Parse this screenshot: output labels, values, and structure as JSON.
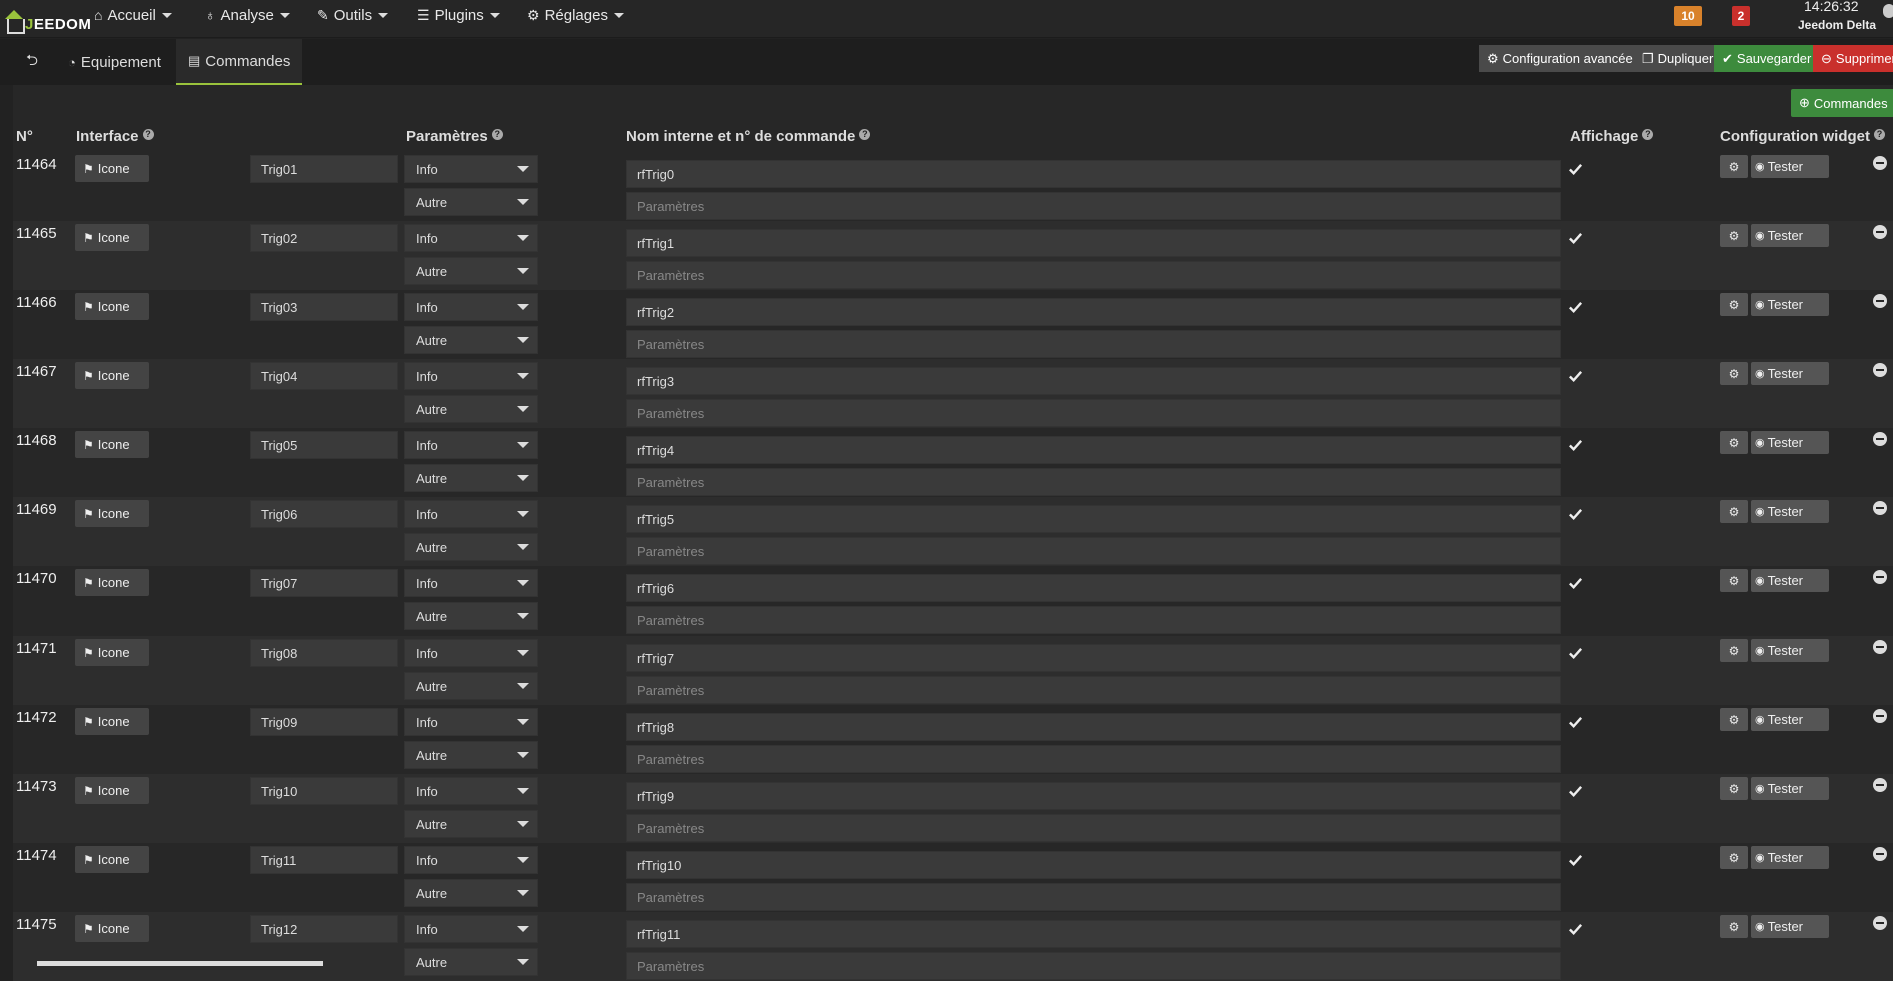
{
  "topbar": {
    "logo_prefix": "J",
    "logo_text": "EEDOM",
    "menus": [
      {
        "icon": "home-icon",
        "glyph": "⌂",
        "label": "Accueil"
      },
      {
        "icon": "stethoscope-icon",
        "glyph": "♁",
        "label": "Analyse"
      },
      {
        "icon": "wrench-icon",
        "glyph": "✎",
        "label": "Outils"
      },
      {
        "icon": "list-icon",
        "glyph": "☰",
        "label": "Plugins"
      },
      {
        "icon": "cogs-icon",
        "glyph": "⚙",
        "label": "Réglages"
      }
    ],
    "badges": [
      {
        "value": "10",
        "color": "#d9822b"
      },
      {
        "value": "2",
        "color": "#c9302c"
      }
    ],
    "time": "14:26:32",
    "host": "Jeedom Delta"
  },
  "tabs": {
    "back_glyph": "⮌",
    "equipement": "Equipement",
    "commandes": "Commandes"
  },
  "actions": {
    "config_avancee": "Configuration avancée",
    "dupliquer": "Dupliquer",
    "sauvegarder": "Sauvegarder",
    "supprimer": "Supprimer",
    "commandes": "Commandes"
  },
  "headers": {
    "num": "N°",
    "interface": "Interface",
    "parametres": "Paramètres",
    "nom_interne": "Nom interne et n° de commande",
    "affichage": "Affichage",
    "config_widget": "Configuration widget"
  },
  "labels": {
    "icone": "Icone",
    "tester": "Tester",
    "params_placeholder": "Paramètres"
  },
  "rows": [
    {
      "id": "11464",
      "name": "Trig01",
      "type": "Info",
      "subtype": "Autre",
      "logical": "rfTrig0"
    },
    {
      "id": "11465",
      "name": "Trig02",
      "type": "Info",
      "subtype": "Autre",
      "logical": "rfTrig1"
    },
    {
      "id": "11466",
      "name": "Trig03",
      "type": "Info",
      "subtype": "Autre",
      "logical": "rfTrig2"
    },
    {
      "id": "11467",
      "name": "Trig04",
      "type": "Info",
      "subtype": "Autre",
      "logical": "rfTrig3"
    },
    {
      "id": "11468",
      "name": "Trig05",
      "type": "Info",
      "subtype": "Autre",
      "logical": "rfTrig4"
    },
    {
      "id": "11469",
      "name": "Trig06",
      "type": "Info",
      "subtype": "Autre",
      "logical": "rfTrig5"
    },
    {
      "id": "11470",
      "name": "Trig07",
      "type": "Info",
      "subtype": "Autre",
      "logical": "rfTrig6"
    },
    {
      "id": "11471",
      "name": "Trig08",
      "type": "Info",
      "subtype": "Autre",
      "logical": "rfTrig7"
    },
    {
      "id": "11472",
      "name": "Trig09",
      "type": "Info",
      "subtype": "Autre",
      "logical": "rfTrig8"
    },
    {
      "id": "11473",
      "name": "Trig10",
      "type": "Info",
      "subtype": "Autre",
      "logical": "rfTrig9"
    },
    {
      "id": "11474",
      "name": "Trig11",
      "type": "Info",
      "subtype": "Autre",
      "logical": "rfTrig10"
    },
    {
      "id": "11475",
      "name": "Trig12",
      "type": "Info",
      "subtype": "Autre",
      "logical": "rfTrig11"
    }
  ]
}
